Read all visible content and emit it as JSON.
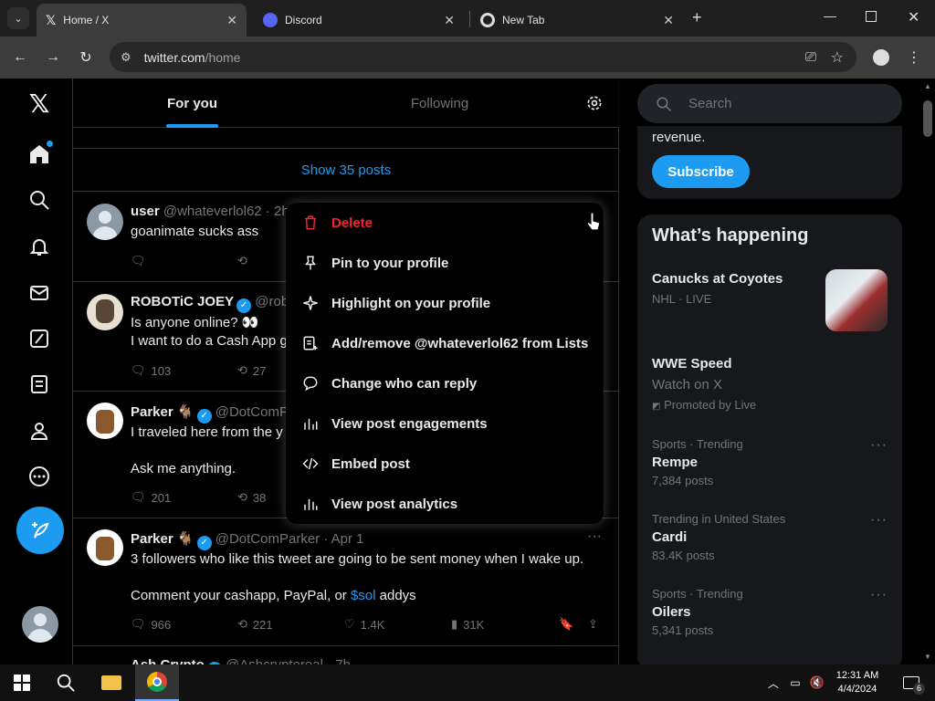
{
  "browser": {
    "tabs": [
      {
        "title": "Home / X",
        "icon": "x-logo-icon"
      },
      {
        "title": "Discord",
        "icon": "discord-icon"
      },
      {
        "title": "New Tab",
        "icon": "chrome-icon"
      }
    ],
    "url_host": "twitter.com",
    "url_path": "/home"
  },
  "timeline": {
    "tabs": [
      {
        "label": "For you"
      },
      {
        "label": "Following"
      }
    ],
    "show_posts": "Show 35 posts",
    "posts": [
      {
        "name": "user",
        "handle": "@whateverlol62 · 2h",
        "lines": [
          "goanimate sucks ass"
        ],
        "metrics": {
          "reply": "",
          "repost": ""
        }
      },
      {
        "name": "ROBOTiC JOEY",
        "handle": "@robo",
        "lines": [
          "Is anyone online? 👀",
          "I want to do a Cash App g"
        ],
        "metrics": {
          "reply": "103",
          "repost": "27"
        }
      },
      {
        "name": "Parker 🐐",
        "handle": "@DotComP",
        "lines": [
          "I traveled here from the y",
          "",
          "Ask me anything."
        ],
        "metrics": {
          "reply": "201",
          "repost": "38"
        }
      },
      {
        "name": "Parker 🐐",
        "handle": "@DotComParker · Apr 1",
        "lines": [
          "3 followers who like this tweet are going to be sent money when I wake up.",
          "",
          "Comment your cashapp, PayPal, or"
        ],
        "cashtag": "$sol",
        "tail": " addys",
        "metrics": {
          "reply": "966",
          "repost": "221",
          "like": "1.4K",
          "views": "31K"
        }
      },
      {
        "name": "Ash Crypto",
        "handle": "@Ashcryptoreal · 7h"
      }
    ]
  },
  "menu": {
    "items": [
      {
        "label": "Delete",
        "icon": "trash-icon",
        "danger": true
      },
      {
        "label": "Pin to your profile",
        "icon": "pin-icon"
      },
      {
        "label": "Highlight on your profile",
        "icon": "sparkle-icon"
      },
      {
        "label": "Add/remove @whateverlol62 from Lists",
        "icon": "list-add-icon"
      },
      {
        "label": "Change who can reply",
        "icon": "speech-bubble-icon"
      },
      {
        "label": "View post engagements",
        "icon": "bar-chart-icon"
      },
      {
        "label": "Embed post",
        "icon": "code-icon"
      },
      {
        "label": "View post analytics",
        "icon": "analytics-icon"
      }
    ]
  },
  "sidebar_right": {
    "search_placeholder": "Search",
    "premium_text": "revenue.",
    "subscribe_label": "Subscribe",
    "whats_happening": "What’s happening",
    "trends": [
      {
        "meta": "NHL · LIVE",
        "name": "Canucks at Coyotes"
      },
      {
        "name": "WWE Speed",
        "sub": "Watch on X",
        "promo": "Promoted by Live"
      },
      {
        "meta": "Sports · Trending",
        "name": "Rempe",
        "count": "7,384 posts"
      },
      {
        "meta": "Trending in United States",
        "name": "Cardi",
        "count": "83.4K posts"
      },
      {
        "meta": "Sports · Trending",
        "name": "Oilers",
        "count": "5,341 posts"
      }
    ]
  },
  "taskbar": {
    "time": "12:31 AM",
    "date": "4/4/2024",
    "notifications": "6"
  },
  "colors": {
    "accent": "#1d9bf0",
    "danger": "#f4212e"
  }
}
